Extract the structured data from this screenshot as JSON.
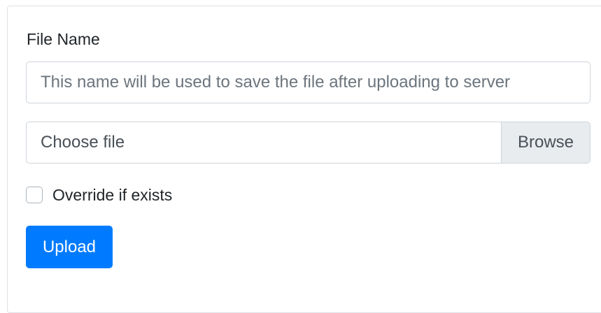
{
  "form": {
    "file_name_label": "File Name",
    "file_name_value": "",
    "file_name_placeholder": "This name will be used to save the file after uploading to server",
    "file_picker_text": "Choose file",
    "browse_label": "Browse",
    "override_label": "Override if exists",
    "override_checked": false,
    "upload_label": "Upload"
  },
  "colors": {
    "primary": "#007bff",
    "browse_bg": "#e9ecef",
    "border": "#ced4da"
  }
}
